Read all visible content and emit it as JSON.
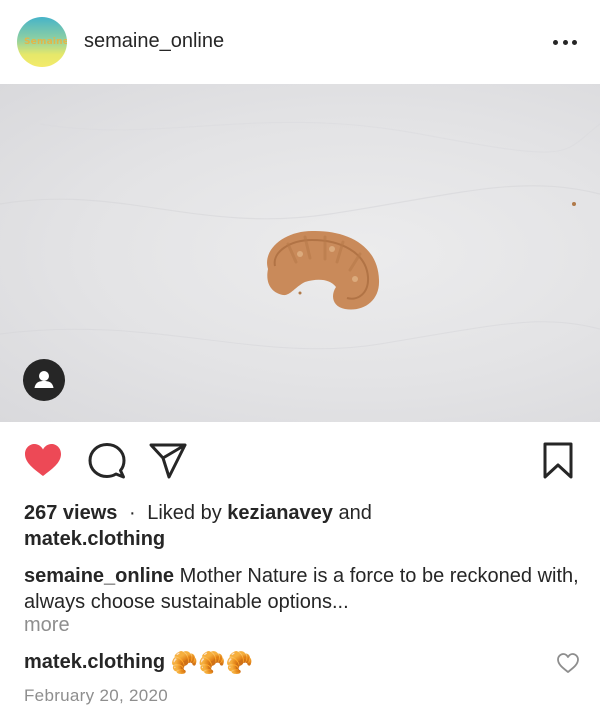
{
  "post": {
    "author": {
      "username": "semaine_online",
      "avatar_text": "Semaine"
    },
    "media": {
      "subject": "croissant-piece"
    },
    "stats": {
      "views": "267 views",
      "separator": "·",
      "liked_by_prefix": "Liked by",
      "liked_by_user": "kezianavey",
      "liked_by_and": "and",
      "liked_by_other": "matek.clothing",
      "liked": true
    },
    "caption": {
      "username": "semaine_online",
      "text": "Mother Nature is a force to be reckoned with, always choose sustainable options...",
      "more_label": "more"
    },
    "comment": {
      "username": "matek.clothing",
      "emoji": "🥐🥐🥐"
    },
    "date": "February 20, 2020"
  },
  "colors": {
    "like": "#ed4956",
    "text": "#262626",
    "muted": "#8e8e8e"
  },
  "icons": [
    "more-horizontal-icon",
    "user-tag-icon",
    "heart-icon",
    "comment-icon",
    "share-icon",
    "bookmark-icon",
    "comment-like-icon"
  ]
}
